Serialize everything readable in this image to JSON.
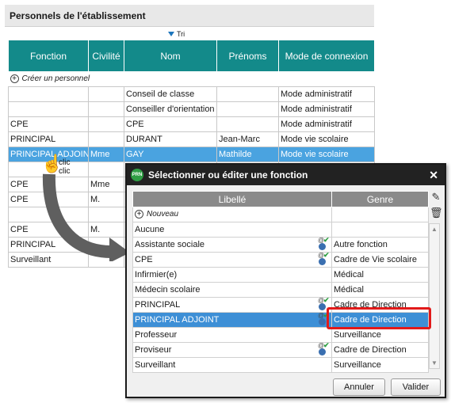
{
  "background": {
    "title": "Personnels de l'établissement",
    "sort_label": "Tri",
    "columns": [
      "Fonction",
      "Civilité",
      "Nom",
      "Prénoms",
      "Mode de connexion"
    ],
    "create_label": "Créer un personnel",
    "rows": [
      [
        "",
        "",
        "Conseil de classe",
        "",
        "Mode administratif"
      ],
      [
        "",
        "",
        "Conseiller d'orientation",
        "",
        "Mode administratif"
      ],
      [
        "CPE",
        "",
        "CPE",
        "",
        "Mode administratif"
      ],
      [
        "PRINCIPAL",
        "",
        "DURANT",
        "Jean-Marc",
        "Mode vie scolaire"
      ],
      [
        "PRINCIPAL ADJOINT",
        "Mme",
        "GAY",
        "Mathilde",
        "Mode vie scolaire"
      ],
      [
        "",
        "",
        "",
        "",
        ""
      ],
      [
        "CPE",
        "Mme",
        "",
        "",
        ""
      ],
      [
        "CPE",
        "M.",
        "",
        "",
        ""
      ],
      [
        "",
        "",
        "",
        "",
        ""
      ],
      [
        "CPE",
        "M.",
        "",
        "",
        ""
      ],
      [
        "PRINCIPAL",
        "",
        "",
        "",
        ""
      ],
      [
        "Surveillant",
        "",
        "",
        "",
        ""
      ]
    ],
    "selected_row": 4
  },
  "annotation": {
    "clic_1": "clic",
    "clic_2": "clic"
  },
  "dialog": {
    "title": "Sélectionner ou éditer une fonction",
    "logo_text": "PRN",
    "close_glyph": "✕",
    "columns": [
      "Libellé",
      "Genre"
    ],
    "create_label": "Nouveau",
    "rows": [
      {
        "libelle": "Aucune",
        "genre": "",
        "icon": false
      },
      {
        "libelle": "Assistante sociale",
        "genre": "Autre fonction",
        "icon": true
      },
      {
        "libelle": "CPE",
        "genre": "Cadre de Vie scolaire",
        "icon": true
      },
      {
        "libelle": "Infirmier(e)",
        "genre": "Médical",
        "icon": false
      },
      {
        "libelle": "Médecin scolaire",
        "genre": "Médical",
        "icon": false
      },
      {
        "libelle": "PRINCIPAL",
        "genre": "Cadre de Direction",
        "icon": true
      },
      {
        "libelle": "PRINCIPAL ADJOINT",
        "genre": "Cadre de Direction",
        "icon": true
      },
      {
        "libelle": "Professeur",
        "genre": "Surveillance",
        "icon": false
      },
      {
        "libelle": "Proviseur",
        "genre": "Cadre de Direction",
        "icon": true
      },
      {
        "libelle": "Surveillant",
        "genre": "Surveillance",
        "icon": false
      }
    ],
    "selected_row": 6,
    "cancel_label": "Annuler",
    "ok_label": "Valider",
    "highlight_color": "#e21a1a",
    "selection_color": "#3d8fd6"
  }
}
